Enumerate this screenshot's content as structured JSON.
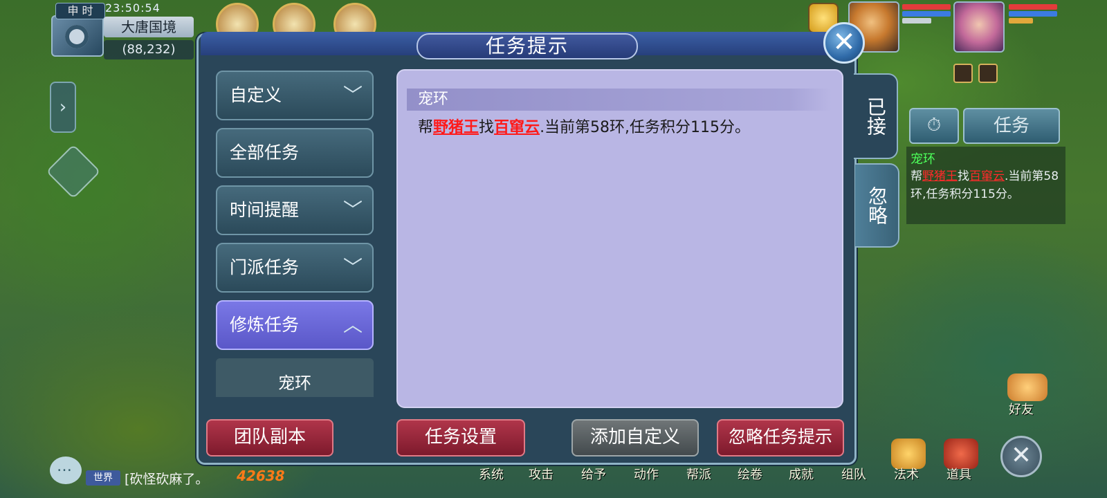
{
  "hud": {
    "time_badge": "申 时",
    "clock": "23:50:54",
    "map_name": "大唐国境",
    "map_coord": "(88,232)"
  },
  "dialog": {
    "title": "任务提示",
    "close_glyph": "✕",
    "menu": [
      {
        "label": "自定义",
        "chevron": "﹀"
      },
      {
        "label": "全部任务",
        "chevron": ""
      },
      {
        "label": "时间提醒",
        "chevron": "﹀"
      },
      {
        "label": "门派任务",
        "chevron": "﹀"
      },
      {
        "label": "修炼任务",
        "chevron": "︿"
      }
    ],
    "sub_item": "宠环",
    "content": {
      "title": "宠环",
      "prefix": "帮",
      "npc1": "野猪王",
      "mid": "找",
      "npc2": "百窜云",
      "suffix": ".当前第58环,任务积分115分。"
    },
    "tabs": {
      "accepted": "已接",
      "ignored": "忽略"
    },
    "buttons": {
      "team_dungeon": "团队副本",
      "task_settings": "任务设置",
      "add_custom": "添加自定义",
      "ignore_prompt": "忽略任务提示"
    }
  },
  "right_panel": {
    "timer_icon": "⏱",
    "task_tab": "任务",
    "task_name": "宠环",
    "text_prefix": "帮",
    "npc1": "野猪王",
    "mid": "找",
    "npc2": "百窜云",
    "suffix": ".当前第58环,任务积分115分。"
  },
  "chat": {
    "channel": "世界",
    "message": "[砍怪砍麻了。",
    "number": "42638"
  },
  "bottom_bar": {
    "labels": [
      "系统",
      "攻击",
      "给予",
      "动作",
      "帮派",
      "绘卷",
      "成就",
      "组队",
      "法术",
      "道具"
    ],
    "friend": "好友",
    "close_glyph": "✕"
  },
  "colors": {
    "dialog_bg": "#2a4659",
    "content_bg": "#b9b6e4",
    "active_menu": "#6a67d8",
    "red_button": "#9a2a3e",
    "npc_red": "#ff1a1a"
  }
}
